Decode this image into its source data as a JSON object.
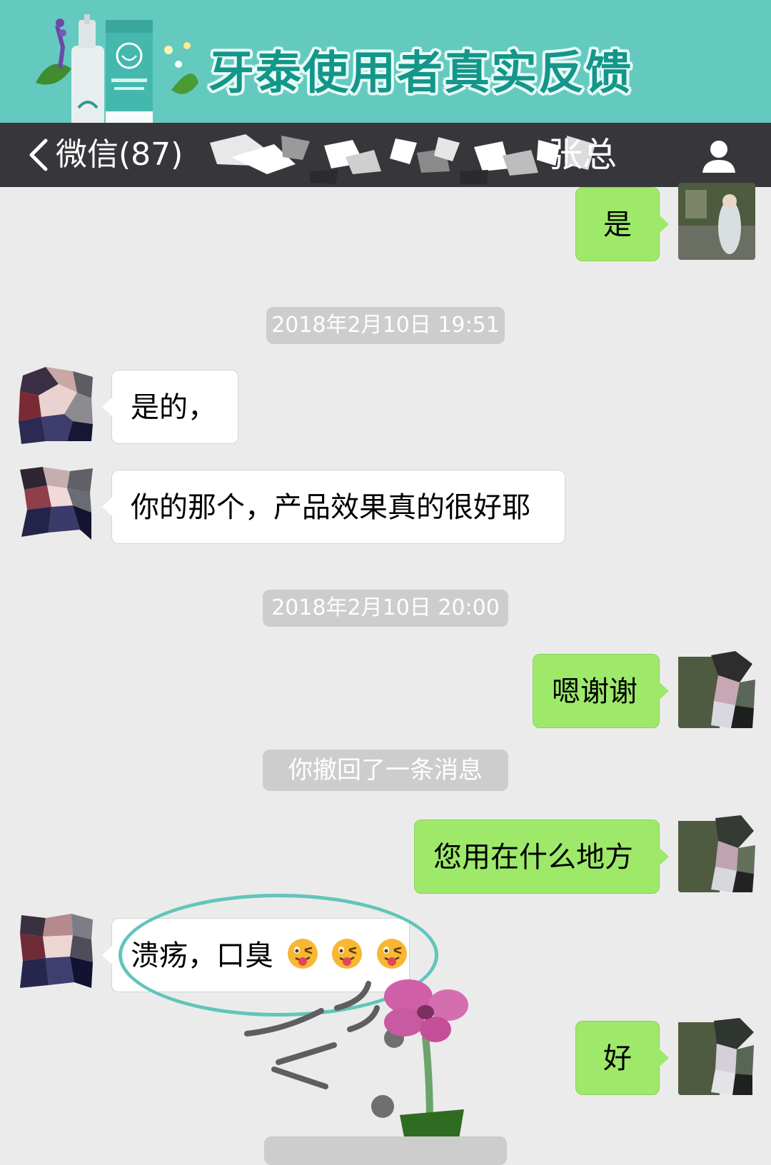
{
  "banner": {
    "title": "牙泰使用者真实反馈",
    "accent_color": "#64cabf",
    "product_icon": "spray-bottle-icon"
  },
  "nav": {
    "back_label": "微信(87)",
    "contact_name": "张总",
    "back_icon": "chevron-left-icon",
    "profile_icon": "person-icon"
  },
  "messages": [
    {
      "type": "text",
      "side": "sent",
      "text": "是"
    },
    {
      "type": "time",
      "text": "2018年2月10日 19:51"
    },
    {
      "type": "text",
      "side": "received",
      "text": "是的，"
    },
    {
      "type": "text",
      "side": "received",
      "text": "你的那个，产品效果真的很好耶"
    },
    {
      "type": "time",
      "text": "2018年2月10日 20:00"
    },
    {
      "type": "text",
      "side": "sent",
      "text": "嗯谢谢"
    },
    {
      "type": "system",
      "text": "你撤回了一条消息"
    },
    {
      "type": "text",
      "side": "sent",
      "text": "您用在什么地方"
    },
    {
      "type": "text",
      "side": "received",
      "text": "溃疡，口臭",
      "emoji": "winking-tongue-face-icon",
      "emoji_count": 3
    },
    {
      "type": "text",
      "side": "sent",
      "text": "好"
    }
  ],
  "colors": {
    "sent_bubble": "#9ee96a",
    "received_bubble": "#ffffff",
    "nav_bar": "#37373b",
    "chat_background": "#ebebeb"
  }
}
